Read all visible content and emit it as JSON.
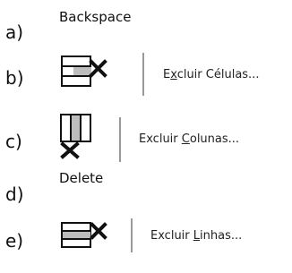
{
  "options": [
    {
      "letter": "a)",
      "text": "Backspace"
    },
    {
      "letter": "b)",
      "cmd_pre": "E",
      "cmd_acc": "x",
      "cmd_post": "cluir Células..."
    },
    {
      "letter": "c)",
      "cmd_pre": "Excluir ",
      "cmd_acc": "C",
      "cmd_post": "olunas..."
    },
    {
      "letter": "d)",
      "text": "Delete"
    },
    {
      "letter": "e)",
      "cmd_pre": "Excluir ",
      "cmd_acc": "L",
      "cmd_post": "inhas..."
    }
  ],
  "icons": {
    "b": "delete-cells-icon",
    "c": "delete-columns-icon",
    "e": "delete-rows-icon"
  },
  "colors": {
    "x_mark": "#111111",
    "separator": "#9a9a9a"
  }
}
